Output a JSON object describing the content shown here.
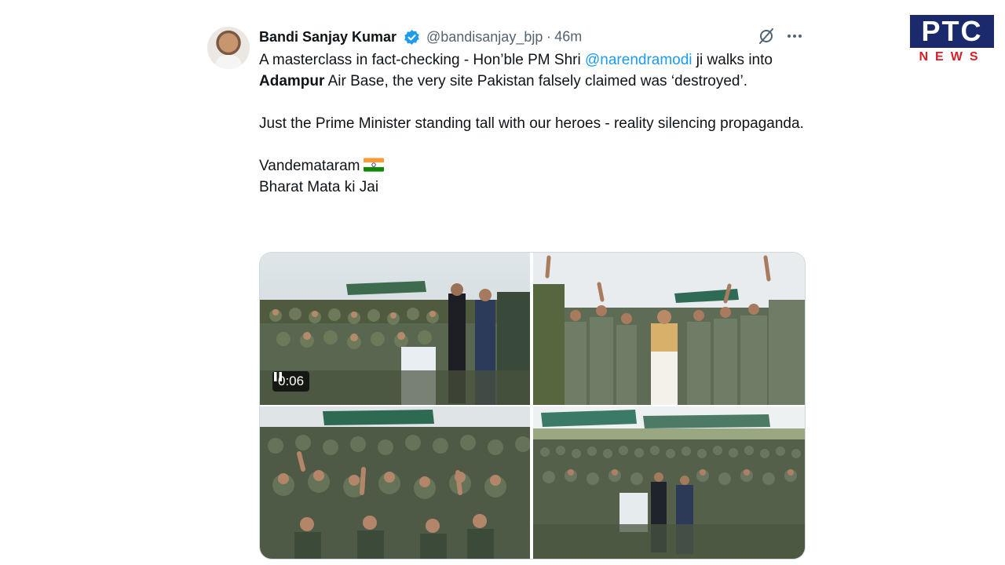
{
  "brand": {
    "logo_top": "PTC",
    "logo_bottom": "NEWS",
    "colors": {
      "logo_blue": "#1a2a6c",
      "logo_red": "#d61f26"
    }
  },
  "tweet": {
    "author_name": "Bandi Sanjay Kumar",
    "verified_icon": "verified-badge-icon",
    "handle": "@bandisanjay_bjp",
    "separator": "·",
    "time": "46m",
    "line1_a": "A masterclass in fact-checking - Hon’ble PM Shri ",
    "mention": "@narendramodi",
    "line1_b": " ji walks into ",
    "bold_place": "Adampur",
    "line1_c": " Air Base, the very site Pakistan falsely claimed was ‘destroyed’.",
    "line2": "Just the Prime Minister standing tall with our heroes - reality silencing propaganda.",
    "line3": "Vandemataram",
    "flag_icon": "india-flag-icon",
    "line4": "Bharat Mata ki Jai",
    "colors": {
      "link": "#1d9bf0",
      "muted": "#536471",
      "text": "#0f1419"
    }
  },
  "media": {
    "video_time": "0:06",
    "video_state_icon": "pause-icon",
    "photo_count": 4
  }
}
